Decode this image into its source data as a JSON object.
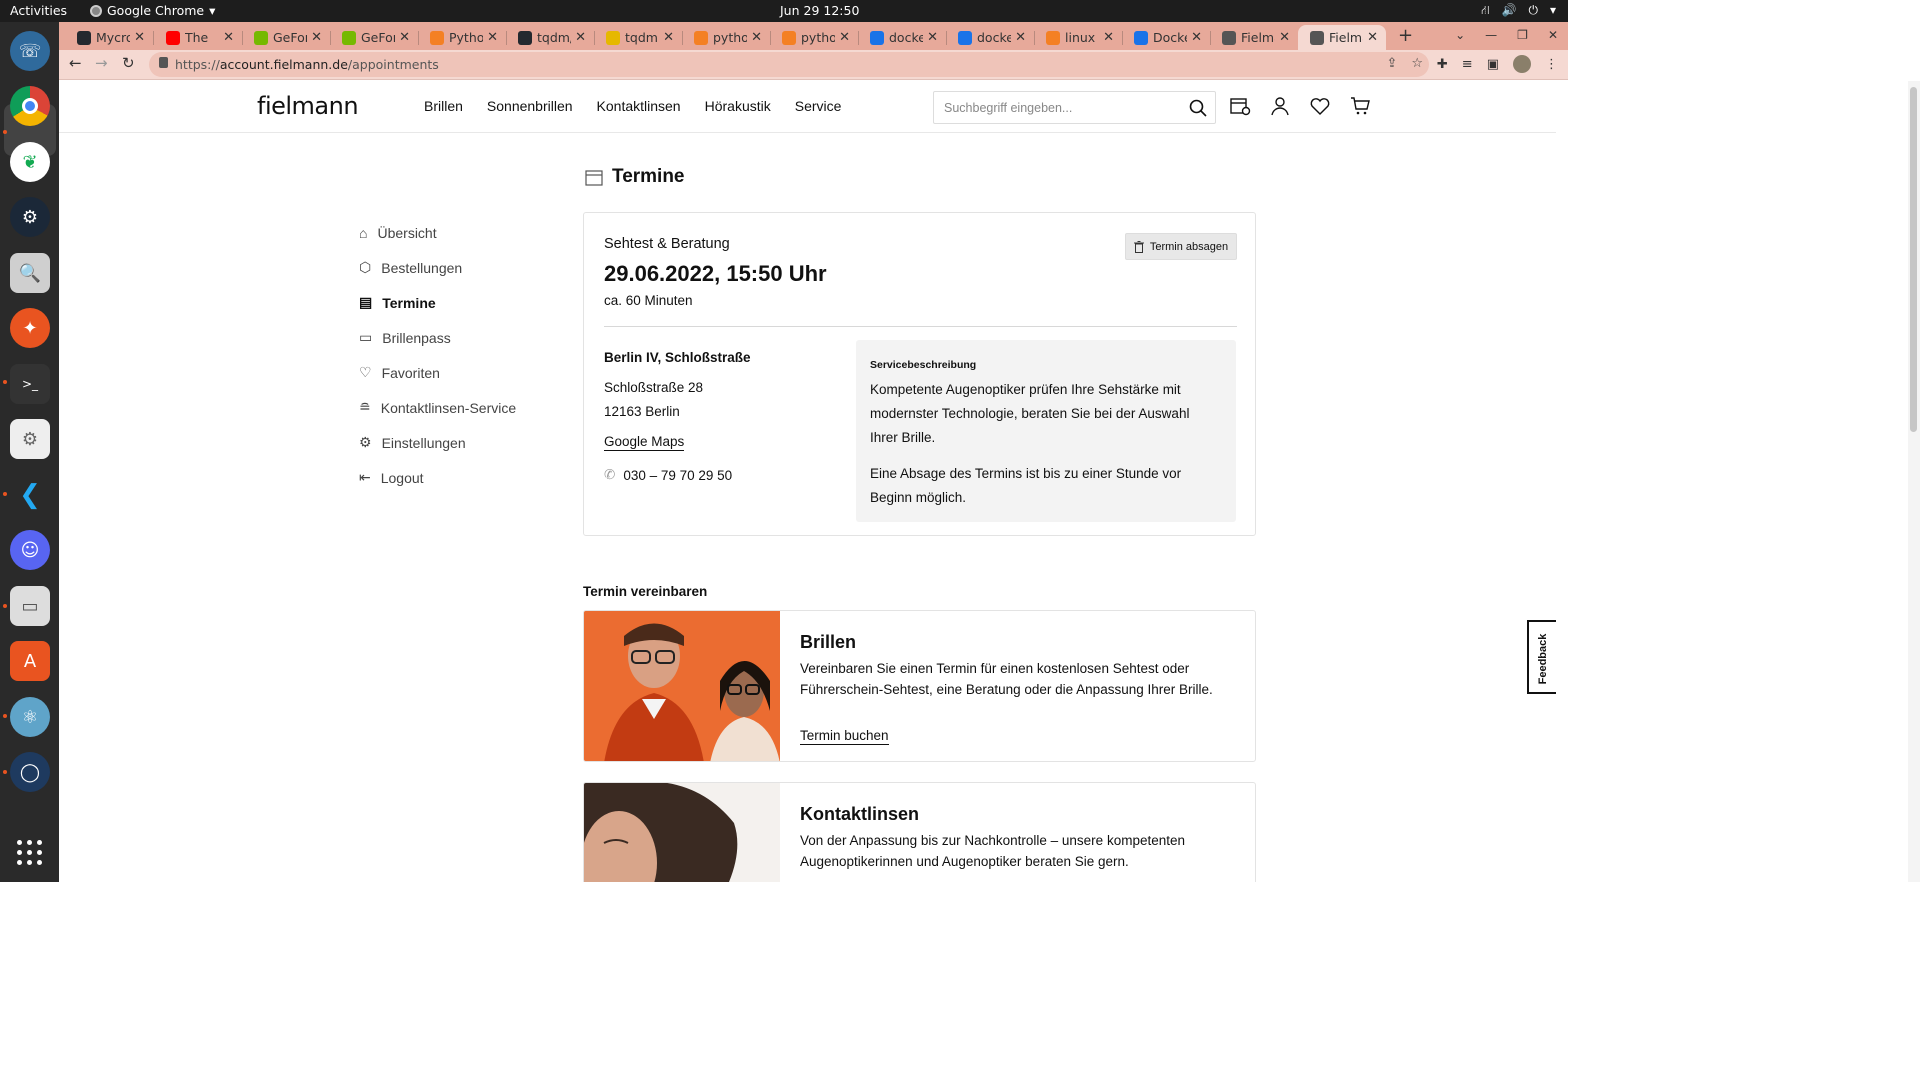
{
  "system": {
    "activities": "Activities",
    "app_name": "Google Chrome",
    "clock": "Jun 29  12:50"
  },
  "browser": {
    "tabs": [
      {
        "label": "Mycro",
        "color": "#24292f"
      },
      {
        "label": "The",
        "color": "#ff0000"
      },
      {
        "label": "GeFor",
        "color": "#76b900"
      },
      {
        "label": "GeFor",
        "color": "#76b900"
      },
      {
        "label": "Pytho",
        "color": "#f48024"
      },
      {
        "label": "tqdm/",
        "color": "#24292f"
      },
      {
        "label": "tqdm.",
        "color": "#e6b800"
      },
      {
        "label": "pytho",
        "color": "#f48024"
      },
      {
        "label": "pytho",
        "color": "#f48024"
      },
      {
        "label": "docke",
        "color": "#1a73e8"
      },
      {
        "label": "docke",
        "color": "#1a73e8"
      },
      {
        "label": "linux -",
        "color": "#f48024"
      },
      {
        "label": "Docke",
        "color": "#1a73e8"
      },
      {
        "label": "Fielma",
        "color": "#555555"
      },
      {
        "label": "Fielma",
        "color": "#555555"
      }
    ],
    "url_prefix": "https://",
    "url_host": "account.fielmann.de",
    "url_path": "/appointments"
  },
  "site": {
    "logo": "fielmann",
    "nav": [
      "Brillen",
      "Sonnenbrillen",
      "Kontaktlinsen",
      "Hörakustik",
      "Service"
    ],
    "search_placeholder": "Suchbegriff eingeben..."
  },
  "sidebar": {
    "items": [
      {
        "label": "Übersicht",
        "icon": "home-icon"
      },
      {
        "label": "Bestellungen",
        "icon": "box-icon"
      },
      {
        "label": "Termine",
        "icon": "calendar-icon"
      },
      {
        "label": "Brillenpass",
        "icon": "card-icon"
      },
      {
        "label": "Favoriten",
        "icon": "heart-icon"
      },
      {
        "label": "Kontaktlinsen-Service",
        "icon": "lens-icon"
      },
      {
        "label": "Einstellungen",
        "icon": "gear-icon"
      },
      {
        "label": "Logout",
        "icon": "logout-icon"
      }
    ],
    "active": "Termine"
  },
  "page_title": "Termine",
  "appointment": {
    "type": "Sehtest & Beratung",
    "datetime": "29.06.2022, 15:50 Uhr",
    "duration": "ca. 60 Minuten",
    "cancel_label": "Termin absagen",
    "store_name": "Berlin IV, Schloßstraße",
    "street": "Schloßstraße 28",
    "city": "12163 Berlin",
    "maps_label": "Google Maps",
    "phone": "030 – 79 70 29 50",
    "service_title": "Servicebeschreibung",
    "service_text": "Kompetente Augenoptiker prüfen Ihre Sehstärke mit modernster Technologie, beraten Sie bei der Auswahl Ihrer Brille.",
    "cancel_note": "Eine Absage des Termins ist bis zu einer Stunde vor Beginn möglich."
  },
  "booking": {
    "heading": "Termin vereinbaren",
    "offers": [
      {
        "title": "Brillen",
        "text": "Vereinbaren Sie einen Termin für einen kostenlosen Sehtest oder Führerschein-Sehtest, eine Beratung oder die Anpassung Ihrer Brille.",
        "link": "Termin buchen"
      },
      {
        "title": "Kontaktlinsen",
        "text": "Von der Anpassung bis zur Nachkontrolle – unsere kompetenten Augenoptikerinnen und Augenoptiker beraten Sie gern."
      }
    ]
  },
  "feedback_label": "Feedback",
  "colors": {
    "tabstrip": "#e7a99a",
    "toolbar": "#f5d9d2",
    "offer_orange": "#e8622a"
  }
}
